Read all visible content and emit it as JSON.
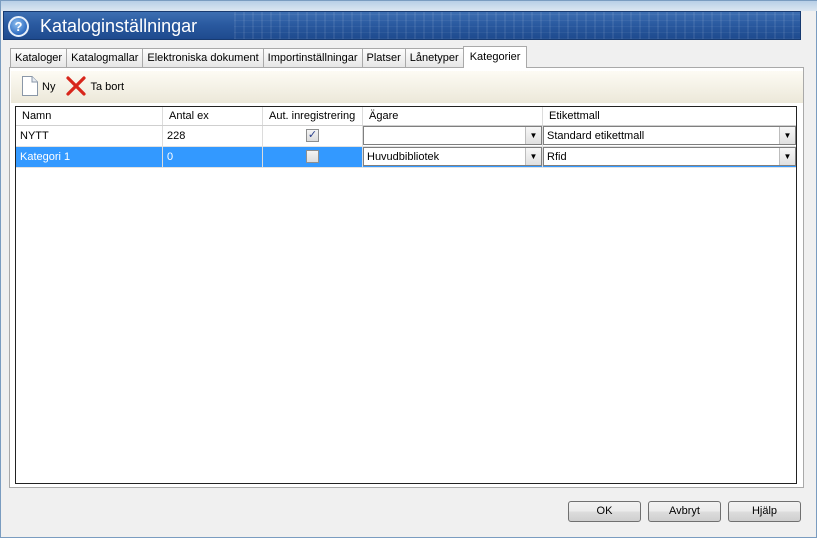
{
  "window": {
    "title": "Kataloginställningar",
    "help_glyph": "?"
  },
  "tabs": [
    {
      "label": "Kataloger"
    },
    {
      "label": "Katalogmallar"
    },
    {
      "label": "Elektroniska dokument"
    },
    {
      "label": "Importinställningar"
    },
    {
      "label": "Platser"
    },
    {
      "label": "Lånetyper"
    },
    {
      "label": "Kategorier",
      "active": true
    }
  ],
  "toolbar": {
    "new_label": "Ny",
    "delete_label": "Ta bort",
    "new_icon": "new-document-icon",
    "delete_icon": "red-x-delete-icon"
  },
  "grid": {
    "columns": [
      "Namn",
      "Antal ex",
      "Aut. inregistrering",
      "Ägare",
      "Etikettmall"
    ],
    "rows": [
      {
        "name": "NYTT",
        "count": "228",
        "auto": true,
        "owner": "",
        "label_template": "Standard etikettmall",
        "selected": false
      },
      {
        "name": "Kategori 1",
        "count": "0",
        "auto": false,
        "owner": "Huvudbibliotek",
        "label_template": "Rfid",
        "selected": true
      }
    ]
  },
  "footer": {
    "ok_label": "OK",
    "cancel_label": "Avbryt",
    "help_label": "Hjälp"
  },
  "colors": {
    "title_bar": "#2a5aa0",
    "selection": "#3399ff"
  }
}
